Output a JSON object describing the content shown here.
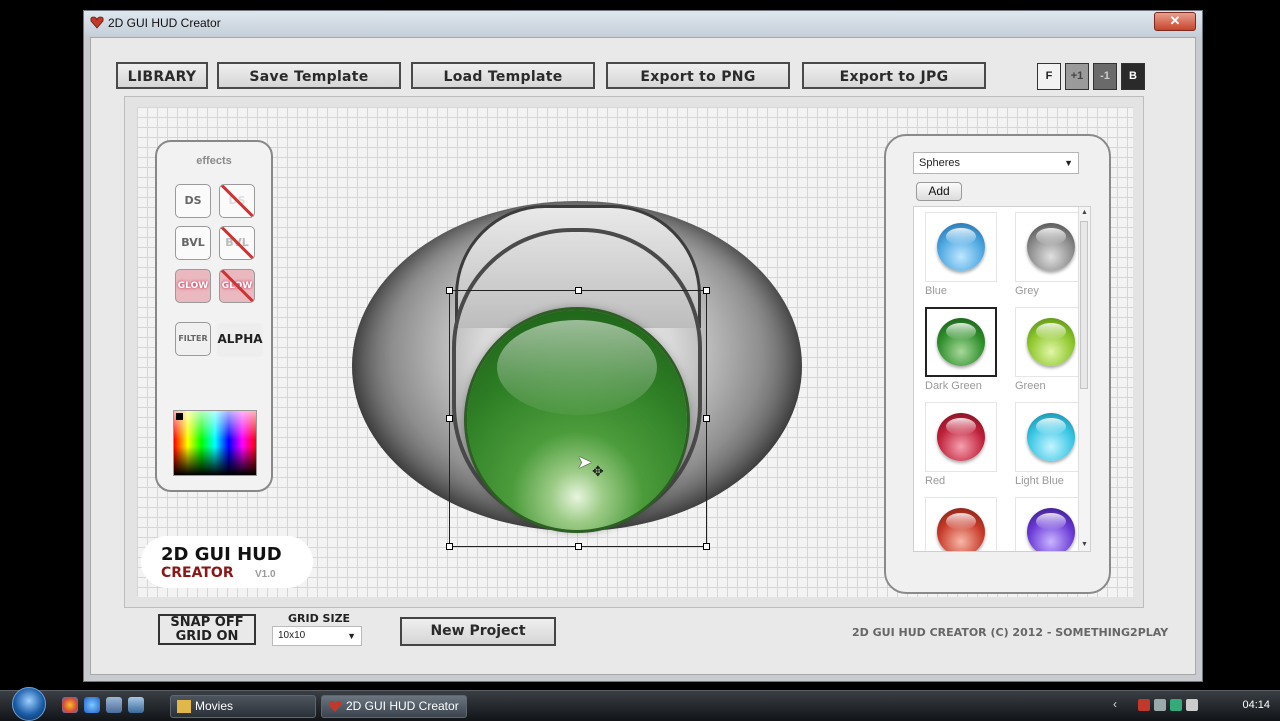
{
  "window": {
    "title": "2D GUI HUD Creator",
    "close": "✕"
  },
  "toolbar": {
    "library": "LIBRARY",
    "save_template": "Save Template",
    "load_template": "Load Template",
    "export_png": "Export to PNG",
    "export_jpg": "Export to JPG",
    "layer_f": "F",
    "layer_plus1": "+1",
    "layer_minus1": "-1",
    "layer_b": "B"
  },
  "effects": {
    "title": "effects",
    "ds_on": "DS",
    "ds_off": "DS",
    "bvl_on": "BVL",
    "bvl_off": "BVL",
    "glow_on": "GLOW",
    "glow_off": "GLOW",
    "filter": "FILTER",
    "alpha": "ALPHA"
  },
  "logo": {
    "line1": "2D GUI HUD",
    "line2": "CREATOR",
    "version": "V1.0"
  },
  "sprites": {
    "category": "Spheres",
    "add": "Add",
    "items": [
      {
        "label": "Blue",
        "color": "#4aa6e0"
      },
      {
        "label": "Grey",
        "color": "#8a8a8a"
      },
      {
        "label": "Dark Green",
        "color": "#2f8f2c",
        "selected": true
      },
      {
        "label": "Green",
        "color": "#8cc62a"
      },
      {
        "label": "Red",
        "color": "#c0213a"
      },
      {
        "label": "Light Blue",
        "color": "#38c6e4"
      },
      {
        "label": "",
        "color": "#c83a2a"
      },
      {
        "label": "",
        "color": "#6a3ad6"
      }
    ]
  },
  "bottom": {
    "snap_off": "SNAP OFF",
    "grid_on": "GRID ON",
    "grid_size_label": "GRID SIZE",
    "grid_size_value": "10x10",
    "new_project": "New Project",
    "copyright": "2D GUI HUD CREATOR (C) 2012 - SOMETHING2PLAY"
  },
  "taskbar": {
    "items": [
      {
        "label": "Movies"
      },
      {
        "label": "2D GUI HUD Creator"
      }
    ],
    "clock": "04:14"
  }
}
